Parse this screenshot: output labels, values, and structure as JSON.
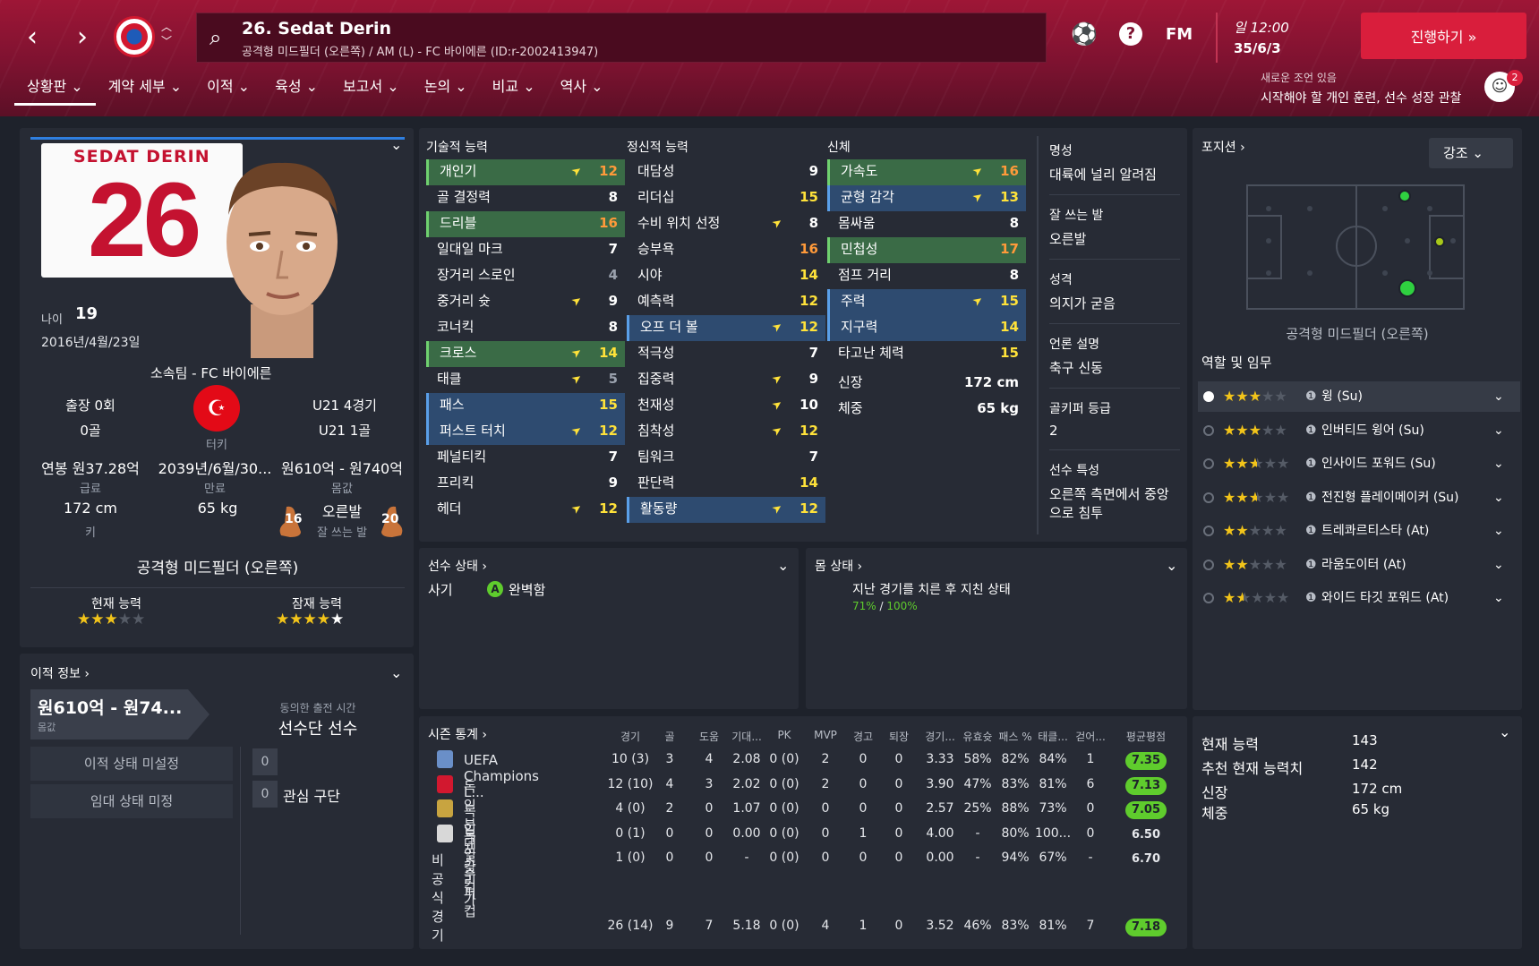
{
  "header": {
    "player_title": "26. Sedat Derin",
    "player_subtitle": "공격형 미드필더 (오른쪽) / AM (L) - FC 바이에른 (ID:r-2002413947)",
    "date_time": "일 12:00",
    "date": "35/6/3",
    "continue_label": "진행하기 »",
    "fm_label": "FM"
  },
  "tabs": [
    "상황판",
    "계약 세부",
    "이적",
    "육성",
    "보고서",
    "논의",
    "비교",
    "역사"
  ],
  "advice": {
    "title": "새로운 조언 있음",
    "text": "시작해야 할 개인 훈련, 선수 성장 관찰",
    "count": "2"
  },
  "profile": {
    "shirt_name": "SEDAT DERIN",
    "shirt_number": "26",
    "age_label": "나이",
    "age": "19",
    "dob": "2016년/4월/23일",
    "club": "소속팀 - FC 바이에른",
    "caps": "출장 0회",
    "goals": "0골",
    "nation": "터키",
    "u21_caps": "U21 4경기",
    "u21_goals": "U21 1골",
    "wage": "연봉 원37.28억",
    "wage_label": "급료",
    "expiry": "2039년/6월/30...",
    "expiry_label": "만료",
    "value": "원610억 - 원740억",
    "value_label": "몸값",
    "height": "172 cm",
    "height_label": "키",
    "weight": "65 kg",
    "foot": "오른발",
    "foot_label": "잘 쓰는 발",
    "left_foot": "16",
    "right_foot": "20",
    "position": "공격형 미드필더 (오른쪽)",
    "ca_label": "현재 능력",
    "pa_label": "잠재 능력",
    "ca_stars": 3,
    "pa_stars": 5
  },
  "transfer": {
    "title": "이적 정보",
    "value": "원610억 - 원74...",
    "value_label": "몸값",
    "playing_time_label": "동의한 출전 시간",
    "playing_time": "선수단 선수",
    "transfer_status": "이적 상태 미설정",
    "loan_status": "임대 상태 미정",
    "count1": "0",
    "count2": "0",
    "interest": "관심 구단"
  },
  "attributes": {
    "technical_title": "기술적 능력",
    "mental_title": "정신적 능력",
    "physical_title": "신체",
    "technical": [
      {
        "name": "개인기",
        "value": "12",
        "hl": "g",
        "arrow": true,
        "color": "o"
      },
      {
        "name": "골 결정력",
        "value": "8",
        "hl": "",
        "arrow": false,
        "color": "w"
      },
      {
        "name": "드리블",
        "value": "16",
        "hl": "g",
        "arrow": false,
        "color": "o"
      },
      {
        "name": "일대일 마크",
        "value": "7",
        "hl": "",
        "arrow": false,
        "color": "w"
      },
      {
        "name": "장거리 스로인",
        "value": "4",
        "hl": "",
        "arrow": false,
        "color": "gy"
      },
      {
        "name": "중거리 슛",
        "value": "9",
        "hl": "",
        "arrow": true,
        "color": "w"
      },
      {
        "name": "코너킥",
        "value": "8",
        "hl": "",
        "arrow": false,
        "color": "w"
      },
      {
        "name": "크로스",
        "value": "14",
        "hl": "g",
        "arrow": true,
        "color": "y"
      },
      {
        "name": "태클",
        "value": "5",
        "hl": "",
        "arrow": true,
        "color": "gy"
      },
      {
        "name": "패스",
        "value": "15",
        "hl": "b",
        "arrow": false,
        "color": "y"
      },
      {
        "name": "퍼스트 터치",
        "value": "12",
        "hl": "b",
        "arrow": true,
        "color": "y"
      },
      {
        "name": "페널티킥",
        "value": "7",
        "hl": "",
        "arrow": false,
        "color": "w"
      },
      {
        "name": "프리킥",
        "value": "9",
        "hl": "",
        "arrow": false,
        "color": "w"
      },
      {
        "name": "헤더",
        "value": "12",
        "hl": "",
        "arrow": true,
        "color": "y"
      }
    ],
    "mental": [
      {
        "name": "대담성",
        "value": "9",
        "hl": "",
        "arrow": false,
        "color": "w"
      },
      {
        "name": "리더십",
        "value": "15",
        "hl": "",
        "arrow": false,
        "color": "y"
      },
      {
        "name": "수비 위치 선정",
        "value": "8",
        "hl": "",
        "arrow": true,
        "color": "w"
      },
      {
        "name": "승부욕",
        "value": "16",
        "hl": "",
        "arrow": false,
        "color": "o"
      },
      {
        "name": "시야",
        "value": "14",
        "hl": "",
        "arrow": false,
        "color": "y"
      },
      {
        "name": "예측력",
        "value": "12",
        "hl": "",
        "arrow": false,
        "color": "y"
      },
      {
        "name": "오프 더 볼",
        "value": "12",
        "hl": "b",
        "arrow": true,
        "color": "y"
      },
      {
        "name": "적극성",
        "value": "7",
        "hl": "",
        "arrow": false,
        "color": "w"
      },
      {
        "name": "집중력",
        "value": "9",
        "hl": "",
        "arrow": true,
        "color": "w"
      },
      {
        "name": "천재성",
        "value": "10",
        "hl": "",
        "arrow": true,
        "color": "w"
      },
      {
        "name": "침착성",
        "value": "12",
        "hl": "",
        "arrow": true,
        "color": "y"
      },
      {
        "name": "팀워크",
        "value": "7",
        "hl": "",
        "arrow": false,
        "color": "w"
      },
      {
        "name": "판단력",
        "value": "14",
        "hl": "",
        "arrow": false,
        "color": "y"
      },
      {
        "name": "활동량",
        "value": "12",
        "hl": "b",
        "arrow": true,
        "color": "y"
      }
    ],
    "physical": [
      {
        "name": "가속도",
        "value": "16",
        "hl": "g",
        "arrow": true,
        "color": "o"
      },
      {
        "name": "균형 감각",
        "value": "13",
        "hl": "b",
        "arrow": true,
        "color": "y"
      },
      {
        "name": "몸싸움",
        "value": "8",
        "hl": "",
        "arrow": false,
        "color": "w"
      },
      {
        "name": "민첩성",
        "value": "17",
        "hl": "g",
        "arrow": false,
        "color": "o"
      },
      {
        "name": "점프 거리",
        "value": "8",
        "hl": "",
        "arrow": false,
        "color": "w"
      },
      {
        "name": "주력",
        "value": "15",
        "hl": "b",
        "arrow": true,
        "color": "y"
      },
      {
        "name": "지구력",
        "value": "14",
        "hl": "b",
        "arrow": false,
        "color": "y"
      },
      {
        "name": "타고난 체력",
        "value": "15",
        "hl": "",
        "arrow": false,
        "color": "y"
      }
    ],
    "height_label": "신장",
    "height": "172 cm",
    "weight_label": "체중",
    "weight": "65 kg",
    "info": [
      {
        "h": "명성",
        "v": "대륙에 널리 알려짐"
      },
      {
        "h": "잘 쓰는 발",
        "v": "오른발"
      },
      {
        "h": "성격",
        "v": "의지가 굳음"
      },
      {
        "h": "언론 설명",
        "v": "축구 신동"
      },
      {
        "h": "골키퍼 등급",
        "v": "2"
      },
      {
        "h": "선수 특성",
        "v": "오른쪽 측면에서 중앙으로 침투"
      }
    ]
  },
  "player_status": {
    "title": "선수 상태",
    "morale_label": "사기",
    "morale": "완벽함"
  },
  "fitness": {
    "title": "몸 상태",
    "text": "지난 경기를 치른 후 지친 상태",
    "condition": "71%",
    "max": "100%"
  },
  "position_panel": {
    "title": "포지션",
    "highlight": "강조",
    "position": "공격형 미드필더 (오른쪽)",
    "roles_title": "역할 및 임무",
    "roles": [
      {
        "name": "윙 (Su)",
        "stars": 3.0
      },
      {
        "name": "인버티드 윙어 (Su)",
        "stars": 3.0
      },
      {
        "name": "인사이드 포워드 (Su)",
        "stars": 2.5
      },
      {
        "name": "전진형 플레이메이커 (Su)",
        "stars": 2.5
      },
      {
        "name": "트레콰르티스타 (At)",
        "stars": 2.0
      },
      {
        "name": "라움도이터 (At)",
        "stars": 2.0
      },
      {
        "name": "와이드 타깃 포워드 (At)",
        "stars": 1.5
      }
    ]
  },
  "season_stats": {
    "title": "시즌 통계",
    "columns": [
      "경기",
      "골",
      "도움",
      "기대...",
      "PK",
      "MVP",
      "경고",
      "퇴장",
      "경기...",
      "유효슛",
      "패스 %",
      "태클...",
      "걷어...",
      "평균평점"
    ],
    "rows": [
      {
        "comp": "UEFA Champions L...",
        "cells": [
          "10 (3)",
          "3",
          "4",
          "2.08",
          "0 (0)",
          "2",
          "0",
          "0",
          "3.33",
          "58%",
          "82%",
          "84%",
          "1"
        ],
        "rating": "7.35",
        "good": true
      },
      {
        "comp": "독일 분데스리가",
        "cells": [
          "12 (10)",
          "4",
          "3",
          "2.02",
          "0 (0)",
          "2",
          "0",
          "0",
          "3.90",
          "47%",
          "83%",
          "81%",
          "6"
        ],
        "rating": "7.13",
        "good": true
      },
      {
        "comp": "독일 포칼 컵",
        "cells": [
          "4 (0)",
          "2",
          "0",
          "1.07",
          "0 (0)",
          "0",
          "0",
          "0",
          "2.57",
          "25%",
          "88%",
          "73%",
          "0"
        ],
        "rating": "7.05",
        "good": true
      },
      {
        "comp": "독일 수퍼컵",
        "cells": [
          "0 (1)",
          "0",
          "0",
          "0.00",
          "0 (0)",
          "0",
          "1",
          "0",
          "4.00",
          "-",
          "80%",
          "100...",
          "0"
        ],
        "rating": "6.50",
        "good": false
      },
      {
        "comp": "비공식 경기",
        "cells": [
          "1 (0)",
          "0",
          "0",
          "-",
          "0 (0)",
          "0",
          "0",
          "0",
          "0.00",
          "-",
          "94%",
          "67%",
          "-"
        ],
        "rating": "6.70",
        "good": false
      }
    ],
    "total": {
      "cells": [
        "26 (14)",
        "9",
        "7",
        "5.18",
        "0 (0)",
        "4",
        "1",
        "0",
        "3.52",
        "46%",
        "83%",
        "81%",
        "7"
      ],
      "rating": "7.18"
    }
  },
  "ability_panel": {
    "rows": [
      {
        "k": "현재 능력",
        "v": "143"
      },
      {
        "k": "추천 현재 능력치",
        "v": "142"
      },
      {
        "k": "신장",
        "v": "172 cm"
      },
      {
        "k": "체중",
        "v": "65 kg"
      }
    ]
  }
}
